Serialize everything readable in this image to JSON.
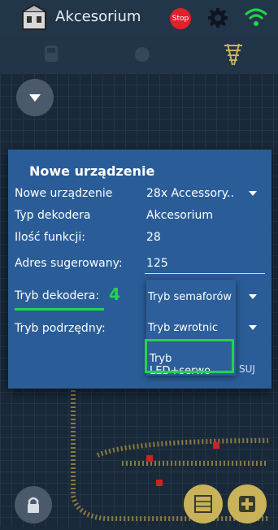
{
  "header": {
    "title": "Akcesorium",
    "stop_label": "Stop"
  },
  "dialog": {
    "title": "Nowe urządzenie",
    "rows": [
      {
        "label": "Nowe urządzenie",
        "value": "28x Accessory.."
      },
      {
        "label": "Typ dekodera",
        "value": "Akcesorium"
      },
      {
        "label": "Ilość funkcji:",
        "value": "28"
      },
      {
        "label": "Adres sugerowany:",
        "value": "125"
      },
      {
        "label": "Tryb dekodera:",
        "value": "Tryb semaforów"
      },
      {
        "label": "Tryb podrzędny:",
        "value": "Tryb zwrotnic"
      }
    ],
    "step_marker": "4",
    "dropdown_options": [
      "Tryb semaforów",
      "Tryb zwrotnic",
      "Tryb LED+serwo"
    ],
    "button_fragment": "SUJ"
  },
  "colors": {
    "accent": "#22d44a",
    "dialog": "#2a5d98",
    "stop": "#e0202a"
  }
}
